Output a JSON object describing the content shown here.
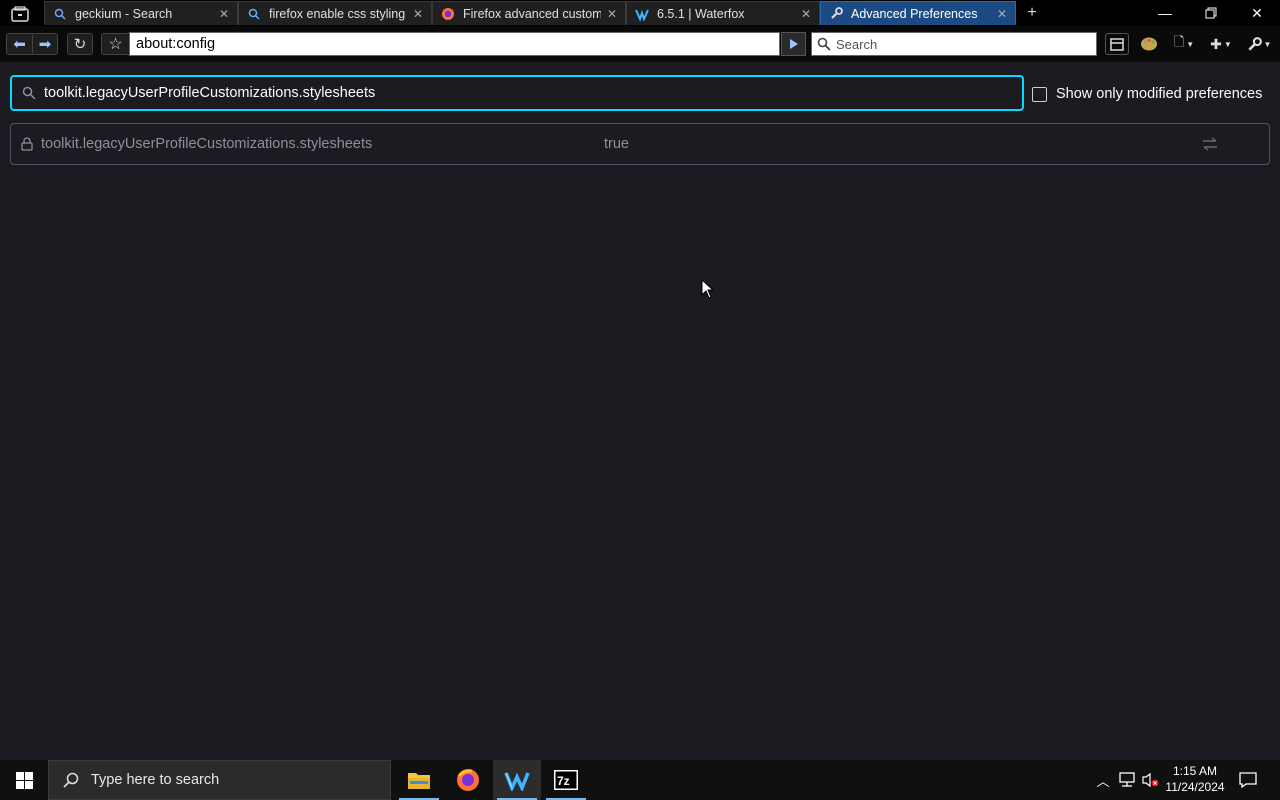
{
  "browser": {
    "tabs": [
      {
        "title": "geckium - Search",
        "favicon": "search-icon",
        "active": false
      },
      {
        "title": "firefox enable css styling - S",
        "favicon": "search-icon",
        "active": false
      },
      {
        "title": "Firefox advanced customiza",
        "favicon": "firefox-icon",
        "active": false
      },
      {
        "title": "6.5.1 | Waterfox",
        "favicon": "waterfox-icon",
        "active": false
      },
      {
        "title": "Advanced Preferences",
        "favicon": "wrench-icon",
        "active": true
      }
    ],
    "url": "about:config",
    "search_placeholder": "Search",
    "accent_color": "#1c4b84"
  },
  "config_page": {
    "filter_value": "toolkit.legacyUserProfileCustomizations.stylesheets",
    "show_modified_label": "Show only modified preferences",
    "show_modified_checked": false,
    "preferences": [
      {
        "name": "toolkit.legacyUserProfileCustomizations.stylesheets",
        "value": "true",
        "locked": true
      }
    ],
    "focus_color": "#00ddff"
  },
  "taskbar": {
    "search_placeholder": "Type here to search",
    "apps": [
      "file-explorer-icon",
      "firefox-icon",
      "waterfox-icon",
      "7zip-icon"
    ],
    "active_app": "waterfox-icon",
    "time": "1:15 AM",
    "date": "11/24/2024"
  }
}
